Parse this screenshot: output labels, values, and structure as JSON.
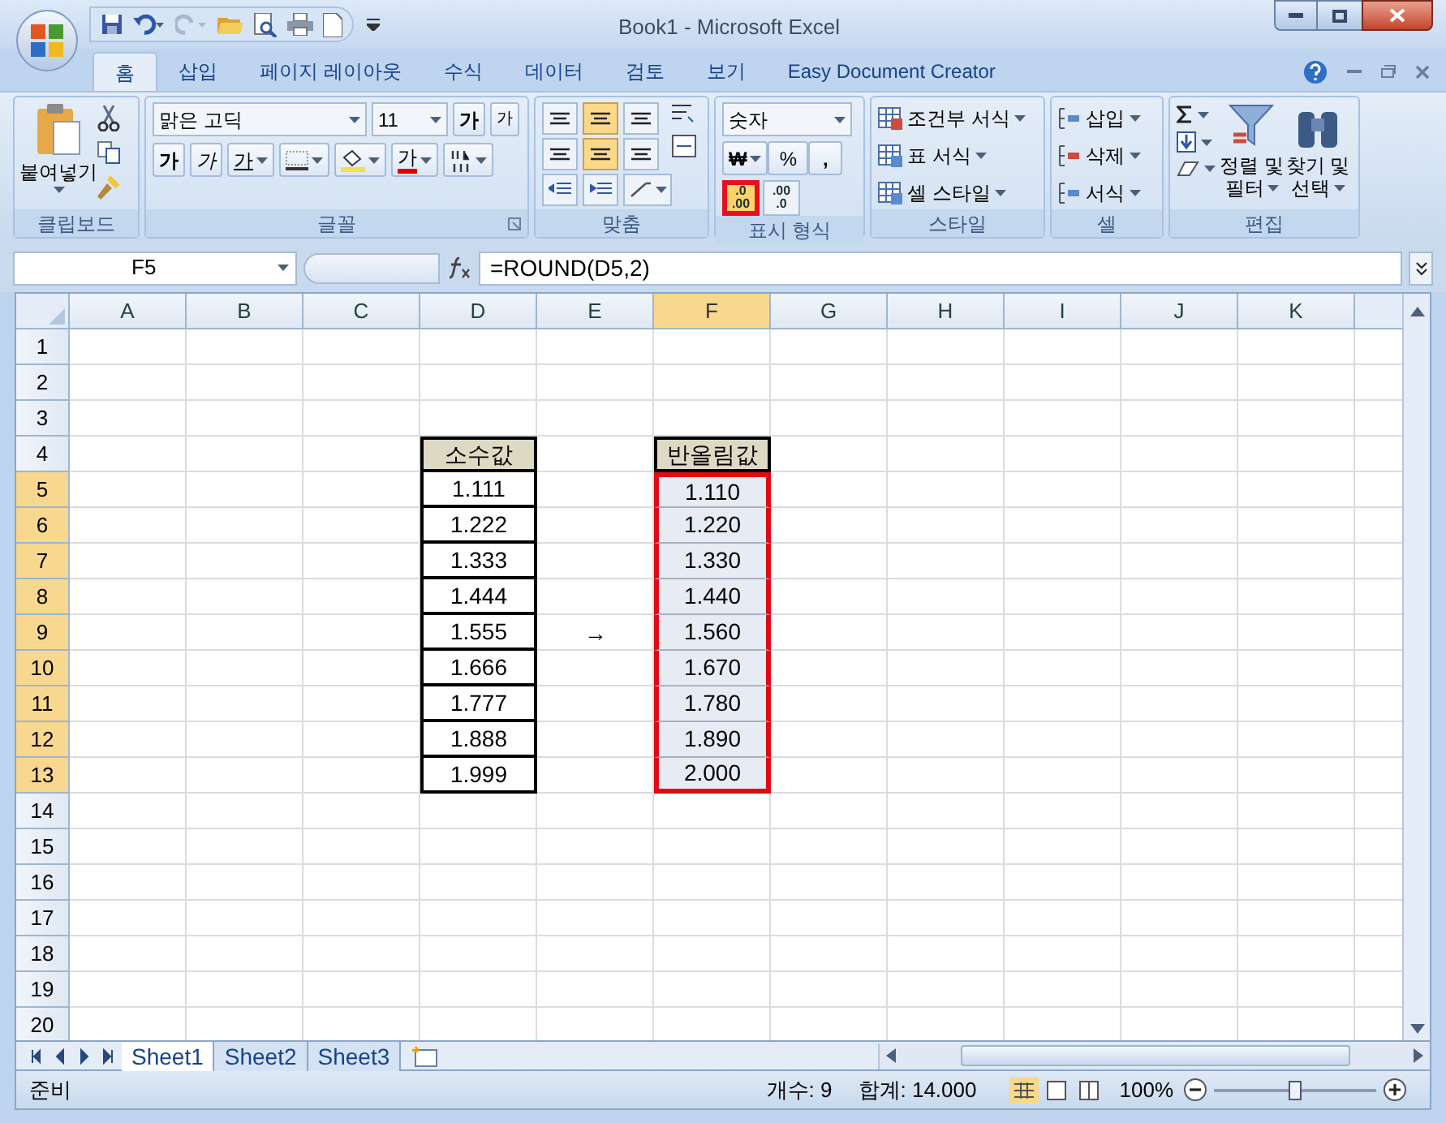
{
  "window": {
    "title": "Book1 - Microsoft Excel"
  },
  "tabs": [
    {
      "label": "홈",
      "selected": true
    },
    {
      "label": "삽입",
      "selected": false
    },
    {
      "label": "페이지 레이아웃",
      "selected": false
    },
    {
      "label": "수식",
      "selected": false
    },
    {
      "label": "데이터",
      "selected": false
    },
    {
      "label": "검토",
      "selected": false
    },
    {
      "label": "보기",
      "selected": false
    },
    {
      "label": "Easy Document Creator",
      "selected": false
    }
  ],
  "ribbon": {
    "clipboard": {
      "label": "클립보드",
      "paste": "붙여넣기"
    },
    "font": {
      "label": "글꼴",
      "font_name": "맑은 고딕",
      "font_size": "11",
      "grow": "가",
      "shrink": "가",
      "bold": "가",
      "italic": "가",
      "underline": "가",
      "font_color": "가"
    },
    "alignment": {
      "label": "맞춤"
    },
    "number": {
      "label": "표시 형식",
      "format": "숫자",
      "currency": "₩",
      "percent": "%",
      "comma": ",",
      "decimal_buttons": [
        {
          "lines": [
            ".0",
            ".00"
          ],
          "highlighted": true
        },
        {
          "lines": [
            ".00",
            ".0"
          ],
          "highlighted": false
        }
      ]
    },
    "styles": {
      "label": "스타일",
      "items": [
        "조건부 서식",
        "표 서식",
        "셀 스타일"
      ]
    },
    "cells": {
      "label": "셀",
      "items": [
        "삽입",
        "삭제",
        "서식"
      ]
    },
    "editing": {
      "label": "편집",
      "sort": [
        "정렬 및",
        "필터"
      ],
      "find": [
        "찾기 및",
        "선택"
      ]
    }
  },
  "formula_bar": {
    "name_box": "F5",
    "formula": "=ROUND(D5,2)"
  },
  "columns": [
    {
      "label": "A",
      "selected": false
    },
    {
      "label": "B",
      "selected": false
    },
    {
      "label": "C",
      "selected": false
    },
    {
      "label": "D",
      "selected": false
    },
    {
      "label": "E",
      "selected": false
    },
    {
      "label": "F",
      "selected": true
    },
    {
      "label": "G",
      "selected": false
    },
    {
      "label": "H",
      "selected": false
    },
    {
      "label": "I",
      "selected": false
    },
    {
      "label": "J",
      "selected": false
    },
    {
      "label": "K",
      "selected": false
    }
  ],
  "rows": [
    {
      "header": "1",
      "selected": false
    },
    {
      "header": "2",
      "selected": false
    },
    {
      "header": "3",
      "selected": false
    },
    {
      "header": "4",
      "selected": false
    },
    {
      "header": "5",
      "selected": true
    },
    {
      "header": "6",
      "selected": true
    },
    {
      "header": "7",
      "selected": true
    },
    {
      "header": "8",
      "selected": true
    },
    {
      "header": "9",
      "selected": true
    },
    {
      "header": "10",
      "selected": true
    },
    {
      "header": "11",
      "selected": true
    },
    {
      "header": "12",
      "selected": true
    },
    {
      "header": "13",
      "selected": true
    },
    {
      "header": "14",
      "selected": false
    },
    {
      "header": "15",
      "selected": false
    },
    {
      "header": "16",
      "selected": false
    },
    {
      "header": "17",
      "selected": false
    },
    {
      "header": "18",
      "selected": false
    },
    {
      "header": "19",
      "selected": false
    },
    {
      "header": "20",
      "selected": false
    }
  ],
  "tables": [
    {
      "heading": "소수값",
      "values": [
        {
          "text": "1.111",
          "selected": false
        },
        {
          "text": "1.222",
          "selected": false
        },
        {
          "text": "1.333",
          "selected": false
        },
        {
          "text": "1.444",
          "selected": false
        },
        {
          "text": "1.555",
          "selected": false
        },
        {
          "text": "1.666",
          "selected": false
        },
        {
          "text": "1.777",
          "selected": false
        },
        {
          "text": "1.888",
          "selected": false
        },
        {
          "text": "1.999",
          "selected": false
        }
      ]
    },
    {
      "heading": "반올림값",
      "values": [
        {
          "text": "1.110",
          "selected": true
        },
        {
          "text": "1.220",
          "selected": true
        },
        {
          "text": "1.330",
          "selected": true
        },
        {
          "text": "1.440",
          "selected": true
        },
        {
          "text": "1.560",
          "selected": true
        },
        {
          "text": "1.670",
          "selected": true
        },
        {
          "text": "1.780",
          "selected": true
        },
        {
          "text": "1.890",
          "selected": true
        },
        {
          "text": "2.000",
          "selected": true
        }
      ]
    }
  ],
  "arrow": "→",
  "sheet_tabs": [
    {
      "label": "Sheet1",
      "selected": true
    },
    {
      "label": "Sheet2",
      "selected": false
    },
    {
      "label": "Sheet3",
      "selected": false
    }
  ],
  "status_bar": {
    "state": "준비",
    "count": "개수: 9",
    "sum": "합계: 14.000",
    "zoom": "100%",
    "zoom_slider": {
      "level": 0.5
    }
  }
}
